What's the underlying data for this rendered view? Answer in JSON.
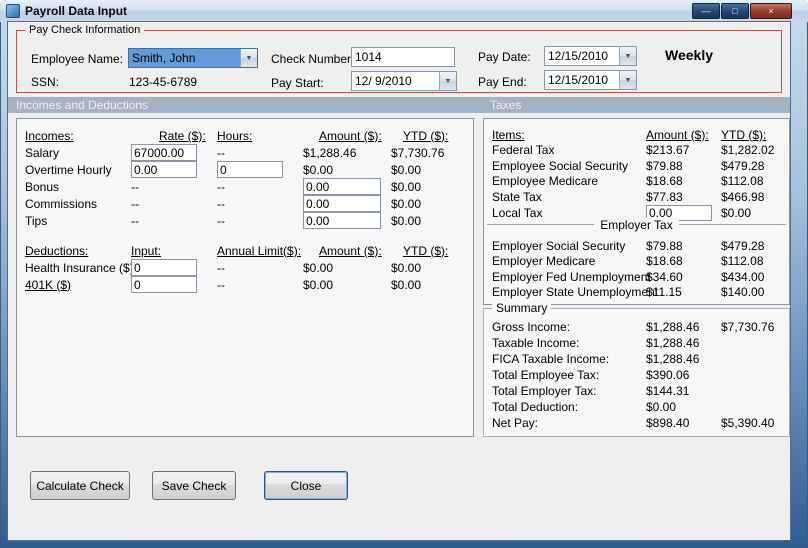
{
  "window": {
    "title": "Payroll Data Input"
  },
  "icons": {
    "minimize": "—",
    "maximize": "□",
    "close": "×",
    "dropdown": "▼"
  },
  "paycheck": {
    "group_label": "Pay Check Information",
    "employee_name_label": "Employee Name:",
    "employee_name_value": "Smith, John",
    "ssn_label": "SSN:",
    "ssn_value": "123-45-6789",
    "check_number_label": "Check Number:",
    "check_number_value": "1014",
    "pay_start_label": "Pay Start:",
    "pay_start_value": "12/ 9/2010",
    "pay_date_label": "Pay Date:",
    "pay_date_value": "12/15/2010",
    "pay_end_label": "Pay End:",
    "pay_end_value": "12/15/2010",
    "frequency": "Weekly"
  },
  "section_headers": {
    "left": "Incomes and Deductions",
    "right": "Taxes"
  },
  "incomes": {
    "headers": {
      "items": "Incomes:",
      "rate": "Rate ($):",
      "hours": "Hours:",
      "amount": "Amount ($):",
      "ytd": "YTD ($):"
    },
    "salary": {
      "label": "Salary",
      "rate": "67000.00",
      "hours": "--",
      "amount": "$1,288.46",
      "ytd": "$7,730.76"
    },
    "overtime": {
      "label": "Overtime Hourly",
      "rate": "0.00",
      "hours": "0",
      "amount": "$0.00",
      "ytd": "$0.00"
    },
    "bonus": {
      "label": "Bonus",
      "rate": "--",
      "hours": "--",
      "amount": "0.00",
      "ytd": "$0.00"
    },
    "commissions": {
      "label": "Commissions",
      "rate": "--",
      "hours": "--",
      "amount": "0.00",
      "ytd": "$0.00"
    },
    "tips": {
      "label": "Tips",
      "rate": "--",
      "hours": "--",
      "amount": "0.00",
      "ytd": "$0.00"
    }
  },
  "deductions": {
    "headers": {
      "items": "Deductions:",
      "input": "Input:",
      "limit": "Annual Limit($):",
      "amount": "Amount ($):",
      "ytd": "YTD ($):"
    },
    "health": {
      "label": "Health Insurance ($)",
      "input": "0",
      "limit": "--",
      "amount": "$0.00",
      "ytd": "$0.00"
    },
    "k401": {
      "label": "401K ($)",
      "input": "0",
      "limit": "--",
      "amount": "$0.00",
      "ytd": "$0.00"
    }
  },
  "taxes": {
    "headers": {
      "items": "Items:",
      "amount": "Amount ($):",
      "ytd": "YTD ($):"
    },
    "federal": {
      "label": "Federal Tax",
      "amount": "$213.67",
      "ytd": "$1,282.02"
    },
    "emp_ss": {
      "label": "Employee Social Security",
      "amount": "$79.88",
      "ytd": "$479.28"
    },
    "emp_medicare": {
      "label": "Employee Medicare",
      "amount": "$18.68",
      "ytd": "$112.08"
    },
    "state": {
      "label": "State Tax",
      "amount": "$77.83",
      "ytd": "$466.98"
    },
    "local": {
      "label": "Local Tax",
      "amount": "0.00",
      "ytd": "$0.00"
    },
    "employer_header": "Employer Tax",
    "empr_ss": {
      "label": "Employer Social Security",
      "amount": "$79.88",
      "ytd": "$479.28"
    },
    "empr_medicare": {
      "label": "Employer Medicare",
      "amount": "$18.68",
      "ytd": "$112.08"
    },
    "empr_fed_unemp": {
      "label": "Employer Fed Unemployment",
      "amount": "$34.60",
      "ytd": "$434.00"
    },
    "empr_state_unemp": {
      "label": "Employer State Unemployment",
      "amount": "$11.15",
      "ytd": "$140.00"
    }
  },
  "summary": {
    "group_label": "Summary",
    "gross": {
      "label": "Gross Income:",
      "amount": "$1,288.46",
      "ytd": "$7,730.76"
    },
    "taxable": {
      "label": "Taxable Income:",
      "amount": "$1,288.46"
    },
    "fica": {
      "label": "FICA Taxable Income:",
      "amount": "$1,288.46"
    },
    "total_emp_tax": {
      "label": "Total Employee Tax:",
      "amount": "$390.06"
    },
    "total_empr_tax": {
      "label": "Total Employer Tax:",
      "amount": "$144.31"
    },
    "total_deduction": {
      "label": "Total Deduction:",
      "amount": "$0.00"
    },
    "net_pay": {
      "label": "Net Pay:",
      "amount": "$898.40",
      "ytd": "$5,390.40"
    }
  },
  "buttons": {
    "calculate": "Calculate Check",
    "save": "Save Check",
    "close": "Close"
  },
  "colors": {
    "group_border": "#b25a4b",
    "section_header_bg": "#a4b2c2",
    "combo_selection": "#639ad8",
    "titlebar_close": "#93402c"
  }
}
